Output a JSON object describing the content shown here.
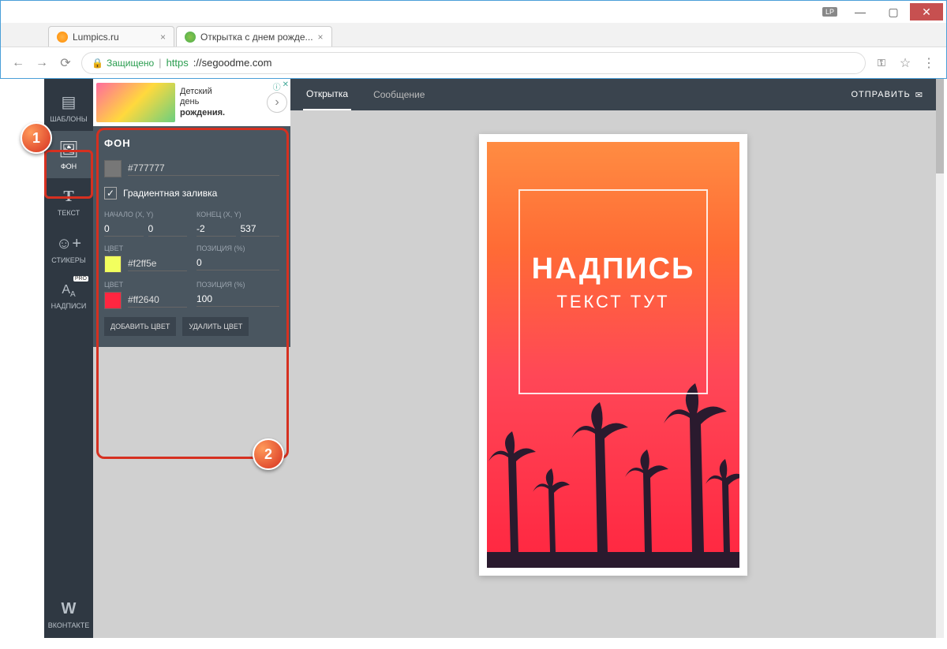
{
  "window": {
    "lp": "LP"
  },
  "tabs": [
    {
      "title": "Lumpics.ru",
      "active": false
    },
    {
      "title": "Открытка с днем рожде...",
      "active": true
    }
  ],
  "addressbar": {
    "secure": "Защищено",
    "protocol": "https",
    "host": "://segoodme.com"
  },
  "ad": {
    "line1": "Детский",
    "line2": "день",
    "line3": "рождения."
  },
  "sidebar": {
    "items": [
      {
        "label": "ШАБЛОНЫ"
      },
      {
        "label": "ФОН"
      },
      {
        "label": "ТЕКСТ"
      },
      {
        "label": "СТИКЕРЫ"
      },
      {
        "label": "НАДПИСИ",
        "pro": "PRO"
      }
    ],
    "bottom": {
      "label": "ВКОНТАКТЕ"
    }
  },
  "panel": {
    "title": "ФОН",
    "baseColor": "#777777",
    "gradient_label": "Градиентная заливка",
    "start_label": "НАЧАЛО (X, Y)",
    "end_label": "КОНЕЦ (X, Y)",
    "start_x": "0",
    "start_y": "0",
    "end_x": "-2",
    "end_y": "537",
    "color_label": "ЦВЕТ",
    "position_label": "ПОЗИЦИЯ (%)",
    "stops": [
      {
        "hex": "#f2ff5e",
        "pos": "0",
        "swatch": "#f2ff5e"
      },
      {
        "hex": "#ff2640",
        "pos": "100",
        "swatch": "#ff2640"
      }
    ],
    "add_btn": "ДОБАВИТЬ ЦВЕТ",
    "del_btn": "УДАЛИТЬ ЦВЕТ"
  },
  "topbar": {
    "tab1": "Открытка",
    "tab2": "Сообщение",
    "send": "ОТПРАВИТЬ"
  },
  "card": {
    "title": "НАДПИСЬ",
    "sub": "ТЕКСТ ТУТ"
  },
  "callouts": {
    "one": "1",
    "two": "2"
  }
}
